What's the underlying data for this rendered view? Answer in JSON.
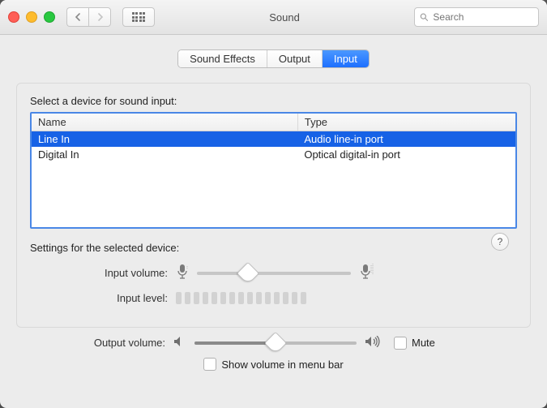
{
  "window": {
    "title": "Sound"
  },
  "search": {
    "placeholder": "Search"
  },
  "tabs": [
    {
      "label": "Sound Effects",
      "active": false
    },
    {
      "label": "Output",
      "active": false
    },
    {
      "label": "Input",
      "active": true
    }
  ],
  "section_label": "Select a device for sound input:",
  "table": {
    "headers": {
      "name": "Name",
      "type": "Type"
    },
    "rows": [
      {
        "name": "Line In",
        "type": "Audio line-in port",
        "selected": true
      },
      {
        "name": "Digital In",
        "type": "Optical digital-in port",
        "selected": false
      }
    ]
  },
  "settings_label": "Settings for the selected device:",
  "input_volume": {
    "label": "Input volume:",
    "value_pct": 33
  },
  "input_level": {
    "label": "Input level:",
    "bars": 15
  },
  "output_volume": {
    "label": "Output volume:",
    "value_pct": 50
  },
  "mute": {
    "label": "Mute",
    "checked": false
  },
  "menu_bar": {
    "label": "Show volume in menu bar",
    "checked": false
  },
  "help": {
    "label": "?"
  }
}
